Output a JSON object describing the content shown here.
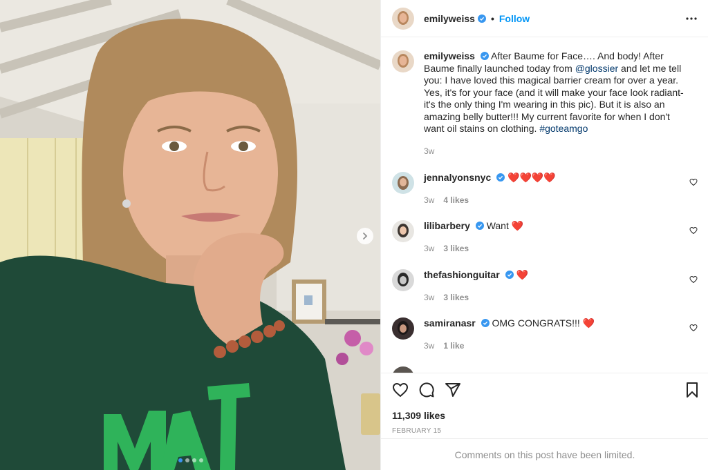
{
  "post": {
    "username": "emilyweiss",
    "follow_label": "Follow",
    "separator": "•",
    "caption": {
      "username": "emilyweiss",
      "text_before_mention": "After Baume for Face…. And body! After Baume finally launched today from ",
      "mention": "@glossier",
      "text_after_mention": " and let me tell you: I have loved this magical barrier cream for over a year. Yes, it's for your face (and it will make your face look radiant- it's the only thing I'm wearing in this pic). But it is also an amazing belly butter!!! My current favorite for when I don't want oil stains on clothing. ",
      "hashtag": "#goteamgo",
      "age": "3w"
    },
    "comments": [
      {
        "username": "jennalyonsnyc",
        "text": "❤️❤️❤️❤️",
        "age": "3w",
        "likes": "4 likes"
      },
      {
        "username": "lilibarbery",
        "text": "Want ❤️",
        "age": "3w",
        "likes": "3 likes"
      },
      {
        "username": "thefashionguitar",
        "text": "❤️",
        "age": "3w",
        "likes": "3 likes"
      },
      {
        "username": "samiranasr",
        "text": "OMG CONGRATS!!! ❤️",
        "age": "3w",
        "likes": "1 like"
      }
    ],
    "likes_count": "11,309 likes",
    "date": "FEBRUARY 15",
    "comments_limited": "Comments on this post have been limited.",
    "carousel": {
      "total": 4,
      "current": 1
    }
  },
  "colors": {
    "accent_blue": "#0095f6",
    "verified_blue": "#3897f0",
    "muted_text": "#8e8e8e",
    "text": "#262626",
    "border": "#efefef"
  },
  "icons": [
    "verified-badge-icon",
    "more-options-icon",
    "chevron-right-icon",
    "heart-icon",
    "comment-icon",
    "share-icon",
    "bookmark-icon"
  ]
}
